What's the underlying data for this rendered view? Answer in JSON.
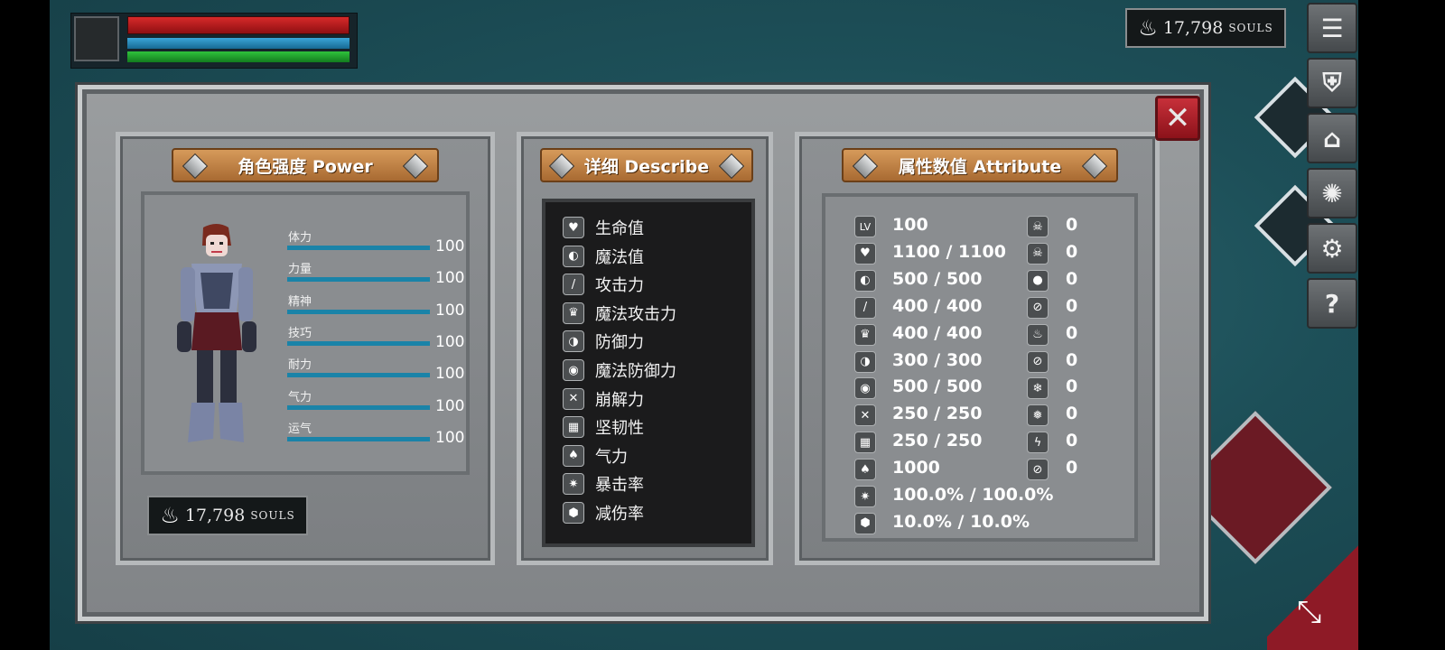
{
  "hud": {
    "hp_level": 1.0,
    "mp_level": 1.0,
    "stamina_level": 1.0
  },
  "souls": {
    "value": "17,798",
    "label": "SOULS",
    "icon": "flame-icon"
  },
  "side_menu": [
    {
      "icon": "menu-list-icon",
      "glyph": "☰"
    },
    {
      "icon": "armor-icon",
      "glyph": "⛨"
    },
    {
      "icon": "helmet-icon",
      "glyph": "⌂"
    },
    {
      "icon": "emblem-icon",
      "glyph": "✺"
    },
    {
      "icon": "gear-icon",
      "glyph": "⚙"
    },
    {
      "icon": "help-icon",
      "glyph": "?"
    }
  ],
  "power": {
    "title": "角色强度 Power",
    "stats": [
      {
        "label": "体力",
        "value": "100",
        "level": 1.0
      },
      {
        "label": "力量",
        "value": "100",
        "level": 1.0
      },
      {
        "label": "精神",
        "value": "100",
        "level": 1.0
      },
      {
        "label": "技巧",
        "value": "100",
        "level": 1.0
      },
      {
        "label": "耐力",
        "value": "100",
        "level": 1.0
      },
      {
        "label": "气力",
        "value": "100",
        "level": 1.0
      },
      {
        "label": "运气",
        "value": "100",
        "level": 1.0
      }
    ]
  },
  "describe": {
    "title": "详细 Describe",
    "items": [
      {
        "label": "生命值",
        "icon": "heart-icon",
        "glyph": "♥"
      },
      {
        "label": "魔法值",
        "icon": "mana-head-icon",
        "glyph": "◐"
      },
      {
        "label": "攻击力",
        "icon": "sword-icon",
        "glyph": "/"
      },
      {
        "label": "魔法攻击力",
        "icon": "magic-attack-icon",
        "glyph": "♛"
      },
      {
        "label": "防御力",
        "icon": "shield-icon",
        "glyph": "◑"
      },
      {
        "label": "魔法防御力",
        "icon": "magic-shield-icon",
        "glyph": "◉"
      },
      {
        "label": "崩解力",
        "icon": "break-icon",
        "glyph": "✕"
      },
      {
        "label": "坚韧性",
        "icon": "toughness-icon",
        "glyph": "▦"
      },
      {
        "label": "气力",
        "icon": "lungs-icon",
        "glyph": "♠"
      },
      {
        "label": "暴击率",
        "icon": "critical-icon",
        "glyph": "✷"
      },
      {
        "label": "减伤率",
        "icon": "damage-reduction-icon",
        "glyph": "⬢"
      }
    ]
  },
  "attribute": {
    "title": "属性数值 Attribute",
    "left": [
      {
        "value": "100",
        "icon": "level-icon",
        "glyph": "LV"
      },
      {
        "value": "1100 / 1100",
        "icon": "heart-icon",
        "glyph": "♥"
      },
      {
        "value": "500 / 500",
        "icon": "mana-head-icon",
        "glyph": "◐"
      },
      {
        "value": "400 / 400",
        "icon": "sword-icon",
        "glyph": "/"
      },
      {
        "value": "400 / 400",
        "icon": "magic-attack-icon",
        "glyph": "♛"
      },
      {
        "value": "300 / 300",
        "icon": "shield-icon",
        "glyph": "◑"
      },
      {
        "value": "500 / 500",
        "icon": "magic-shield-icon",
        "glyph": "◉"
      },
      {
        "value": "250 / 250",
        "icon": "break-icon",
        "glyph": "✕"
      },
      {
        "value": "250 / 250",
        "icon": "toughness-icon",
        "glyph": "▦"
      },
      {
        "value": "1000",
        "icon": "lungs-icon",
        "glyph": "♠"
      },
      {
        "value": "100.0% / 100.0%",
        "icon": "critical-icon",
        "glyph": "✷"
      },
      {
        "value": "10.0% / 10.0%",
        "icon": "damage-reduction-icon",
        "glyph": "⬢"
      }
    ],
    "right": [
      {
        "value": "0",
        "icon": "poison-skull-icon",
        "glyph": "☠"
      },
      {
        "value": "0",
        "icon": "toxic-skull-icon",
        "glyph": "☠"
      },
      {
        "value": "0",
        "icon": "bleed-icon",
        "glyph": "●"
      },
      {
        "value": "0",
        "icon": "bleed-resist-icon",
        "glyph": "⊘"
      },
      {
        "value": "0",
        "icon": "fire-icon",
        "glyph": "♨"
      },
      {
        "value": "0",
        "icon": "fire-resist-icon",
        "glyph": "⊘"
      },
      {
        "value": "0",
        "icon": "frost-icon",
        "glyph": "❄"
      },
      {
        "value": "0",
        "icon": "frost-resist-icon",
        "glyph": "❅"
      },
      {
        "value": "0",
        "icon": "lightning-icon",
        "glyph": "ϟ"
      },
      {
        "value": "0",
        "icon": "lightning-resist-icon",
        "glyph": "⊘"
      }
    ]
  },
  "colors": {
    "accent_header": "#c4884a",
    "hp": "#d72a2a",
    "mp": "#3aa6d8",
    "stamina": "#2fc33c",
    "close": "#b0222b"
  }
}
